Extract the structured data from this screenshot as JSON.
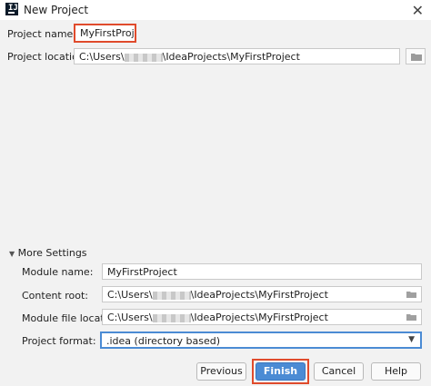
{
  "window": {
    "title": "New Project"
  },
  "form": {
    "project_name_label": "Project name:",
    "project_name_value": "MyFirstProject",
    "project_location_label": "Project location:",
    "project_location_prefix": "C:\\Users\\",
    "project_location_suffix": "\\IdeaProjects\\MyFirstProject"
  },
  "more_settings": {
    "header": "More Settings",
    "module_name_label": "Module name:",
    "module_name_value": "MyFirstProject",
    "content_root_label": "Content root:",
    "content_root_prefix": "C:\\Users\\",
    "content_root_suffix": "\\IdeaProjects\\MyFirstProject",
    "module_file_location_label": "Module file location:",
    "module_file_location_prefix": "C:\\Users\\",
    "module_file_location_suffix": "\\IdeaProjects\\MyFirstProject",
    "project_format_label": "Project format:",
    "project_format_value": ".idea (directory based)"
  },
  "buttons": {
    "previous": "Previous",
    "finish": "Finish",
    "cancel": "Cancel",
    "help": "Help"
  },
  "colors": {
    "highlight": "#e04b2c",
    "primary": "#4b8bd4"
  },
  "icons": [
    "intellij-app-icon",
    "close-icon",
    "folder-icon",
    "chevron-down-icon",
    "dropdown-arrow-icon"
  ]
}
